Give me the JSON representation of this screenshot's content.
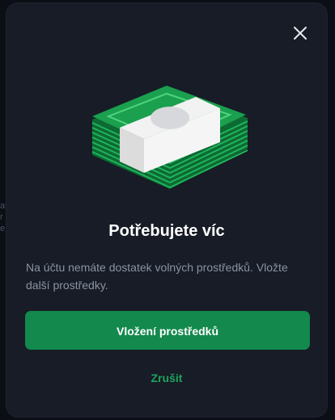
{
  "background": {
    "sliver_text": [
      "al",
      "r",
      "e"
    ]
  },
  "dialog": {
    "close_icon": "close-icon",
    "illustration": "money-stack-icon",
    "title": "Potřebujete víc",
    "message": "Na účtu nemáte dostatek volných prostředků. Vložte další prostředky.",
    "primary_button_label": "Vložení prostředků",
    "cancel_label": "Zrušit"
  },
  "colors": {
    "dialog_background": "#171c26",
    "primary_button": "#13894d",
    "cancel_link": "#1fa35f",
    "money_green": "#1aa04e",
    "money_band": "#f2f2f2"
  }
}
